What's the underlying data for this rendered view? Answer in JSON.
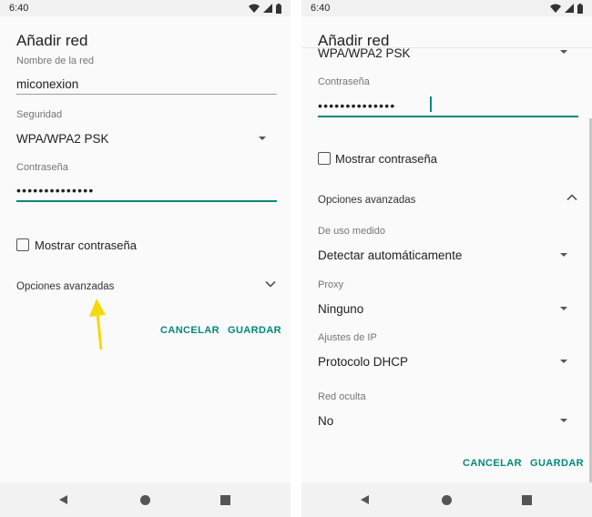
{
  "status_bar": {
    "time": "6:40"
  },
  "left_dialog": {
    "title": "Añadir red",
    "network_name_label": "Nombre de la red",
    "network_name_value": "miconexion",
    "security_label": "Seguridad",
    "security_value": "WPA/WPA2 PSK",
    "password_label": "Contraseña",
    "password_value": "••••••••••••••",
    "show_password_label": "Mostrar contraseña",
    "advanced_label": "Opciones avanzadas",
    "cancel_label": "CANCELAR",
    "save_label": "GUARDAR"
  },
  "right_dialog": {
    "title": "Añadir red",
    "security_value": "WPA/WPA2 PSK",
    "password_label": "Contraseña",
    "password_value": "••••••••••••••",
    "show_password_label": "Mostrar contraseña",
    "advanced_label": "Opciones avanzadas",
    "metered_label": "De uso medido",
    "metered_value": "Detectar automáticamente",
    "proxy_label": "Proxy",
    "proxy_value": "Ninguno",
    "ip_label": "Ajustes de IP",
    "ip_value": "Protocolo DHCP",
    "hidden_label": "Red oculta",
    "hidden_value": "No",
    "cancel_label": "CANCELAR",
    "save_label": "GUARDAR"
  },
  "colors": {
    "accent": "#00897b",
    "arrow_annotation": "#f5d90a"
  },
  "icons": [
    "wifi-icon",
    "signal-icon",
    "battery-icon",
    "dropdown-arrow-icon",
    "chevron-down-icon",
    "chevron-up-icon",
    "checkbox-icon",
    "back-icon",
    "home-icon",
    "recents-icon",
    "annotation-arrow-icon"
  ]
}
